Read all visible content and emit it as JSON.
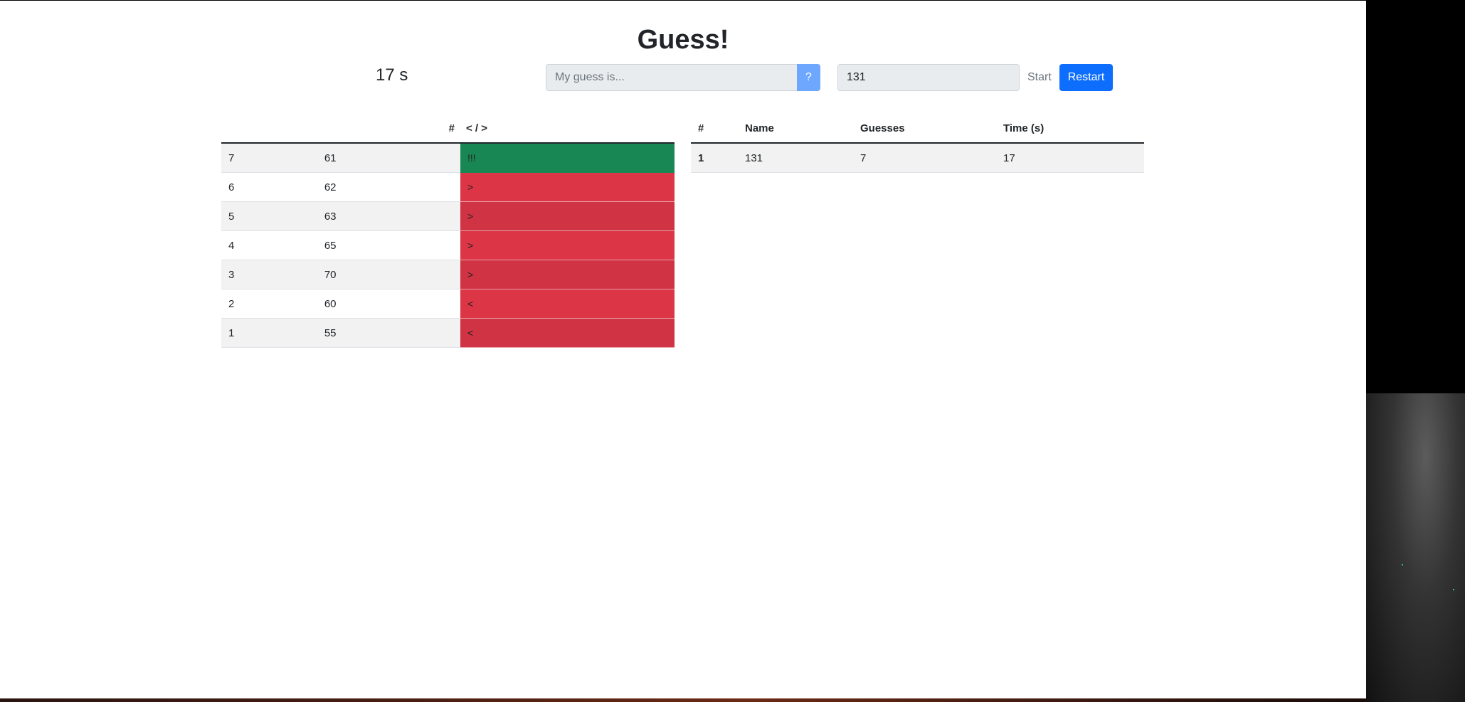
{
  "title": "Guess!",
  "timer": "17 s",
  "guess_input": {
    "placeholder": "My guess is...",
    "value": ""
  },
  "guess_button": "?",
  "name_input": {
    "value": "131"
  },
  "start_button": "Start",
  "restart_button": "Restart",
  "guess_table": {
    "headers": [
      "",
      "#",
      "< / >"
    ],
    "rows": [
      {
        "n": "7",
        "guess": "61",
        "result": "!!!"
      },
      {
        "n": "6",
        "guess": "62",
        "result": ">"
      },
      {
        "n": "5",
        "guess": "63",
        "result": ">"
      },
      {
        "n": "4",
        "guess": "65",
        "result": ">"
      },
      {
        "n": "3",
        "guess": "70",
        "result": ">"
      },
      {
        "n": "2",
        "guess": "60",
        "result": "<"
      },
      {
        "n": "1",
        "guess": "55",
        "result": "<"
      }
    ]
  },
  "score_table": {
    "headers": [
      "#",
      "Name",
      "Guesses",
      "Time (s)"
    ],
    "rows": [
      {
        "rank": "1",
        "name": "131",
        "guesses": "7",
        "time": "17"
      }
    ]
  },
  "colors": {
    "correct": "#198754",
    "wrong": "#dc3545",
    "primary": "#0d6efd"
  }
}
